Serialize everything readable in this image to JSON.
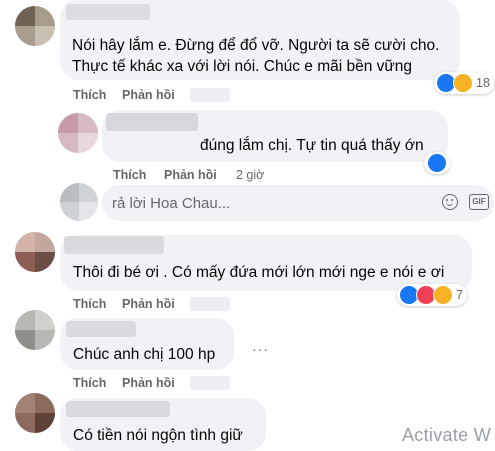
{
  "comments": [
    {
      "author": "",
      "lines": [
        "Nói hây lắm e. Đừng để đổ vỡ. Người ta sẽ cười cho.",
        "Thực tế khác xa với lời nói. Chúc e mãi bền vững"
      ],
      "actions": {
        "like": "Thích",
        "reply": "Phản hồi"
      },
      "reaction_count": "18"
    },
    {
      "author": "",
      "lines": [
        "đúng lắm chị. Tự tin quá thấy ớn"
      ],
      "actions": {
        "like": "Thích",
        "reply": "Phản hồi"
      },
      "time": "2 giờ"
    },
    {
      "author": "",
      "lines": [
        "Thôi đi bé ơi . Có mấy đứa mới lớn mới nge e nói e ơi"
      ],
      "actions": {
        "like": "Thích",
        "reply": "Phản hồi"
      },
      "reaction_count": "7"
    },
    {
      "author": "",
      "lines": [
        "Chúc anh chị 100 hp"
      ],
      "actions": {
        "like": "Thích",
        "reply": "Phản hồi"
      }
    },
    {
      "author": "",
      "lines": [
        "Có tiền nói ngộn tình giữ"
      ]
    }
  ],
  "reply_box": {
    "placeholder": "rả lời Hoa Chau...",
    "icons": [
      "emoji-icon",
      "camera-icon",
      "gif-icon"
    ],
    "gif_label": "GIF"
  },
  "watermark": "Activate W",
  "colors": {
    "bubble": "#f0f2f5",
    "like_blue": "#1877f2",
    "haha_yellow": "#f7b125",
    "love_red": "#f33e58",
    "meta_gray": "#65676b"
  }
}
